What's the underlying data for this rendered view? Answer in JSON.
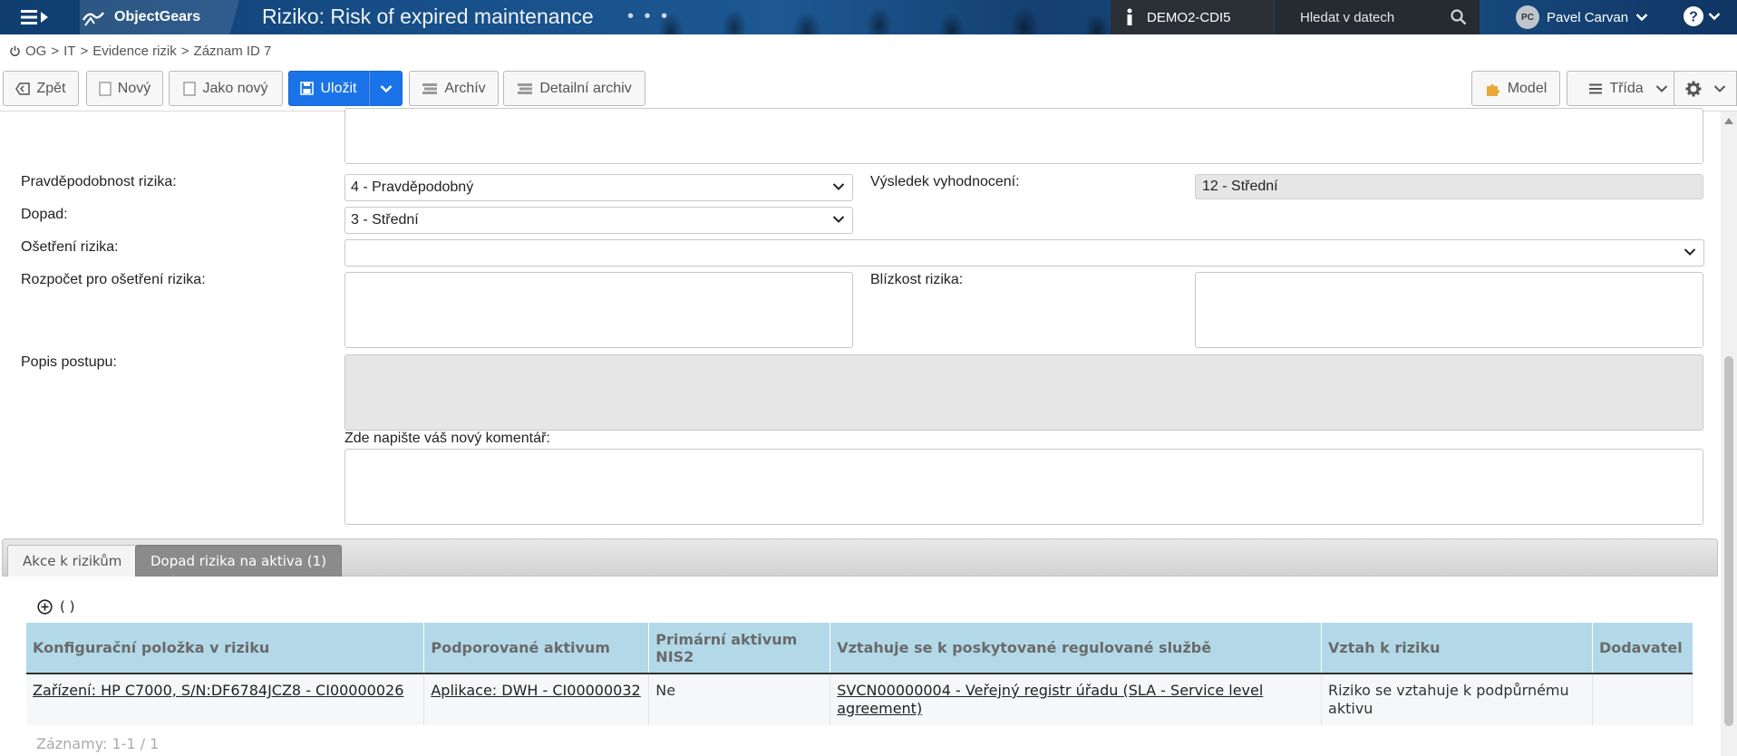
{
  "header": {
    "logo": "ObjectGears",
    "title": "Riziko: Risk of expired maintenance",
    "dots": "• • •",
    "environment": "DEMO2-CDI5",
    "search_placeholder": "Hledat v datech",
    "user_initials": "PC",
    "user_name": "Pavel Carvan"
  },
  "breadcrumb": {
    "items": [
      "OG",
      "IT",
      "Evidence rizik",
      "Záznam ID 7"
    ],
    "separator": ">"
  },
  "toolbar": {
    "back": "Zpět",
    "new": "Nový",
    "as_new": "Jako nový",
    "save": "Uložit",
    "archive": "Archív",
    "detail_archive": "Detailní archiv",
    "model": "Model",
    "class": "Třída"
  },
  "form": {
    "probability_label": "Pravděpodobnost rizika:",
    "probability_value": "4 - Pravděpodobný",
    "evaluation_label": "Výsledek vyhodnocení:",
    "evaluation_value": "12 - Střední",
    "impact_label": "Dopad:",
    "impact_value": "3 - Střední",
    "treatment_label": "Ošetření rizika:",
    "treatment_value": "",
    "budget_label": "Rozpočet pro ošetření rizika:",
    "proximity_label": "Blízkost rizika:",
    "procedure_label": "Popis postupu:",
    "comment_label": "Zde napište váš nový komentář:"
  },
  "tabs": [
    {
      "label": "Akce k rizikům",
      "active": false
    },
    {
      "label": "Dopad rizika na aktiva (1)",
      "active": true
    }
  ],
  "grid": {
    "add_label": "( )",
    "columns": [
      "Konfigurační položka v riziku",
      "Podporované aktivum",
      "Primární aktivum NIS2",
      "Vztahuje se k poskytované regulované službě",
      "Vztah k riziku",
      "Dodavatel"
    ],
    "rows": [
      {
        "ci": "Zařízení: HP C7000, S/N:DF6784JCZ8 - CI00000026",
        "asset": "Aplikace: DWH - CI00000032",
        "primary_nis2": "Ne",
        "service": "SVCN00000004 - Veřejný registr úřadu (SLA - Service level agreement)",
        "relation": "Riziko se vztahuje k podpůrnému aktivu",
        "supplier": ""
      }
    ],
    "records": "Záznamy: 1-1 / 1"
  },
  "colors": {
    "primary": "#1a73e8",
    "grid_header": "#b3d9e8",
    "active_tab": "#8b8b8b"
  }
}
